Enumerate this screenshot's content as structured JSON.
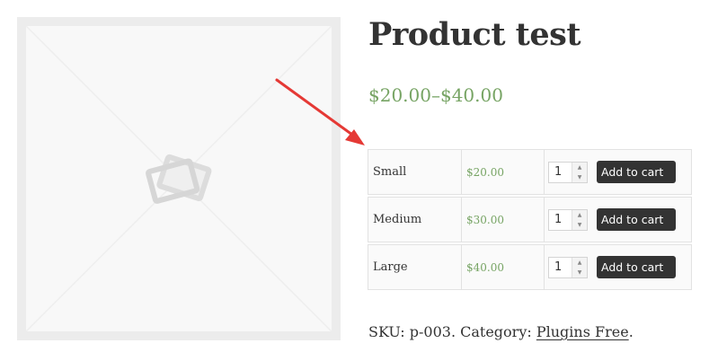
{
  "product": {
    "title": "Product test",
    "price_range": "$20.00–$40.00"
  },
  "image": {
    "icon": "image-placeholder-icon"
  },
  "variations": [
    {
      "name": "Small",
      "price": "$20.00",
      "qty": "1",
      "button": "Add to cart"
    },
    {
      "name": "Medium",
      "price": "$30.00",
      "qty": "1",
      "button": "Add to cart"
    },
    {
      "name": "Large",
      "price": "$40.00",
      "qty": "1",
      "button": "Add to cart"
    }
  ],
  "meta": {
    "sku_label": "SKU:",
    "sku_value": "p-003",
    "category_label": "Category:",
    "category_link": "Plugins Free"
  },
  "annotation": {
    "arrow_color": "#e53935"
  },
  "colors": {
    "price": "#77a464",
    "button_bg": "#333333"
  }
}
